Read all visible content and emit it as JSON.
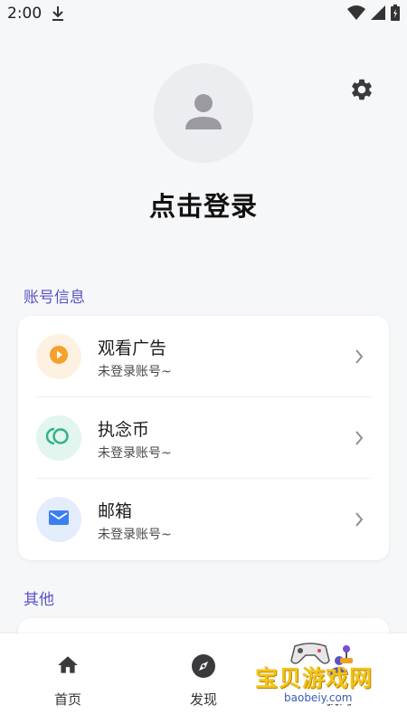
{
  "status_bar": {
    "time": "2:00",
    "icons": [
      "download-icon",
      "wifi-icon",
      "signal-icon",
      "battery-icon"
    ]
  },
  "profile": {
    "login_prompt": "点击登录",
    "avatar_icon": "user-icon",
    "settings_icon": "gear-icon"
  },
  "account_section": {
    "title": "账号信息",
    "items": [
      {
        "title": "观看广告",
        "subtitle": "未登录账号~",
        "icon": "play-icon",
        "icon_color": "#f5a12b",
        "icon_bg": "#fdf1e1"
      },
      {
        "title": "执念币",
        "subtitle": "未登录账号~",
        "icon": "coin-icon",
        "icon_color": "#2fb38a",
        "icon_bg": "#e2f5ee"
      },
      {
        "title": "邮箱",
        "subtitle": "未登录账号~",
        "icon": "mail-icon",
        "icon_color": "#3b7ff0",
        "icon_bg": "#e4edfc"
      }
    ]
  },
  "other_section": {
    "title": "其他"
  },
  "bottom_nav": {
    "items": [
      {
        "label": "首页",
        "icon": "home-icon"
      },
      {
        "label": "发现",
        "icon": "compass-icon"
      },
      {
        "label": "我的",
        "icon": "profile-icon"
      }
    ]
  },
  "watermark": {
    "text": "宝贝游戏网",
    "url": "baobeiy.com"
  },
  "colors": {
    "accent": "#5b53c7",
    "background": "#f6f7f9"
  }
}
